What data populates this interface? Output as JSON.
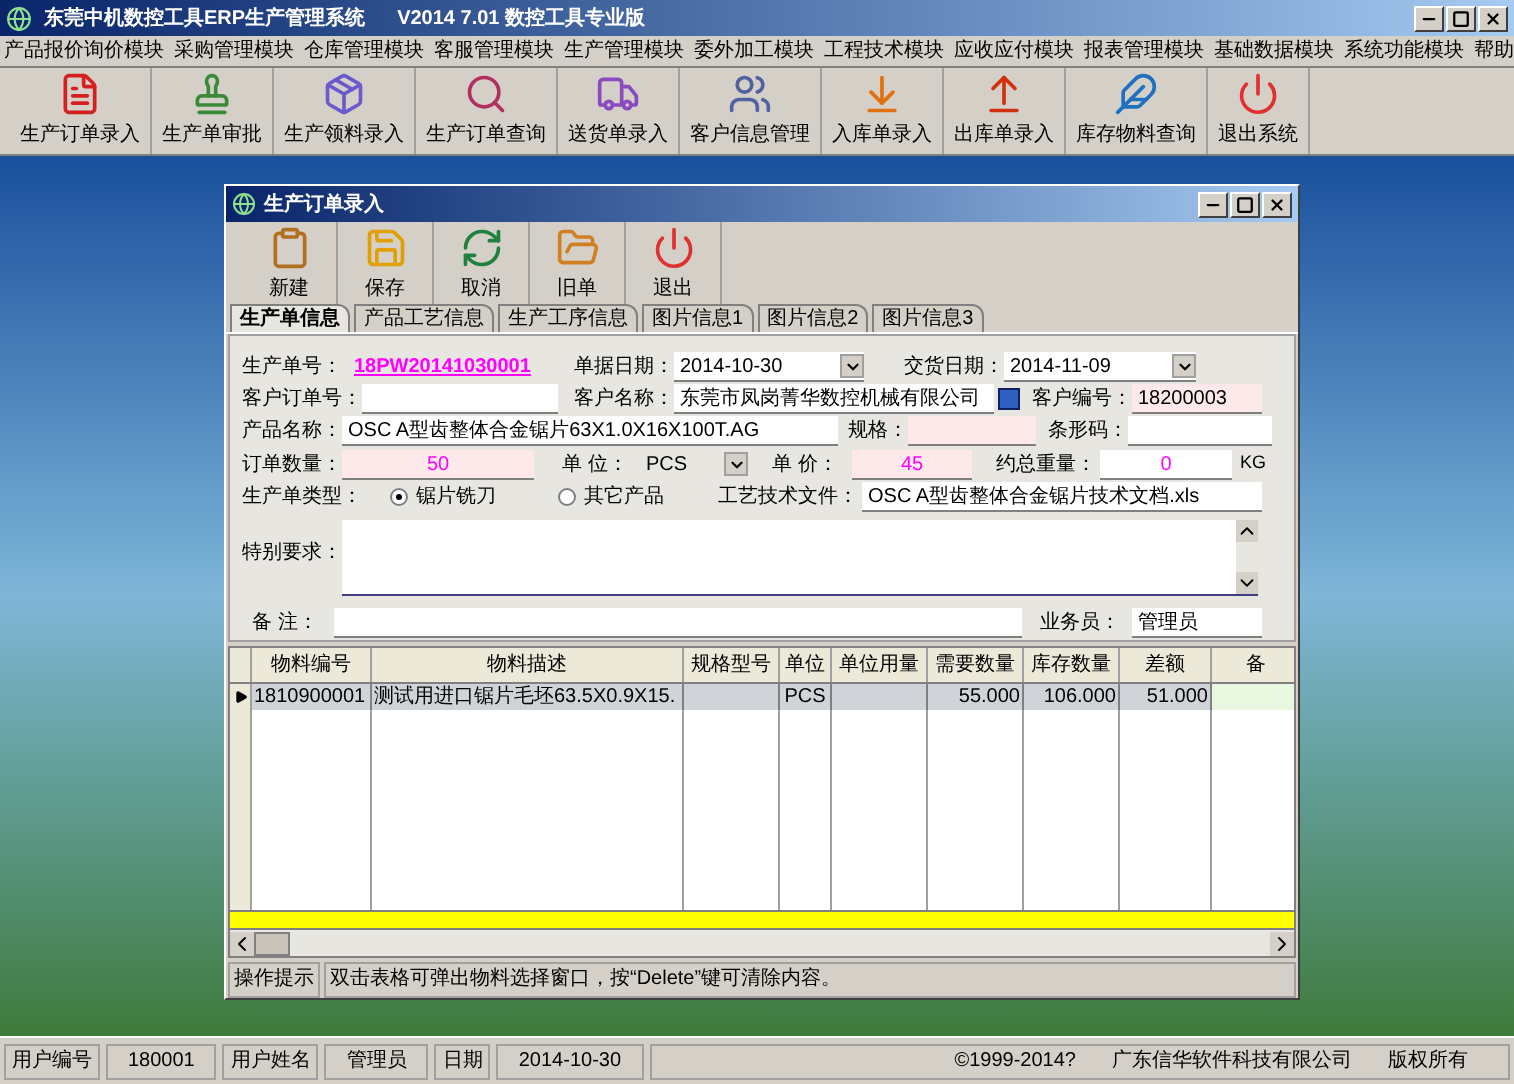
{
  "window": {
    "title": "东莞中机数控工具ERP生产管理系统",
    "edition": "V2014 7.01 数控工具专业版"
  },
  "menu": [
    "产品报价询价模块",
    "采购管理模块",
    "仓库管理模块",
    "客服管理模块",
    "生产管理模块",
    "委外加工模块",
    "工程技术模块",
    "应收应付模块",
    "报表管理模块",
    "基础数据模块",
    "系统功能模块",
    "帮助"
  ],
  "toolbar": [
    "生产订单录入",
    "生产单审批",
    "生产领料录入",
    "生产订单查询",
    "送货单录入",
    "客户信息管理",
    "入库单录入",
    "出库单录入",
    "库存物料查询",
    "退出系统"
  ],
  "dialog": {
    "title": "生产订单录入",
    "toolbar": [
      "新建",
      "保存",
      "取消",
      "旧单",
      "退出"
    ],
    "tabs": [
      {
        "label": "生产单信息",
        "selected": true
      },
      {
        "label": "产品工艺信息",
        "selected": false
      },
      {
        "label": "生产工序信息",
        "selected": false
      },
      {
        "label": "图片信息1",
        "selected": false
      },
      {
        "label": "图片信息2",
        "selected": false
      },
      {
        "label": "图片信息3",
        "selected": false
      }
    ],
    "form": {
      "order_no": {
        "label": "生产单号：",
        "value": "18PW20141030001"
      },
      "doc_date": {
        "label": "单据日期：",
        "value": "2014-10-30"
      },
      "delivery_date": {
        "label": "交货日期：",
        "value": "2014-11-09"
      },
      "customer_order_no": {
        "label": "客户订单号："
      },
      "customer_name": {
        "label": "客户名称：",
        "value": "东莞市凤岗菁华数控机械有限公司"
      },
      "customer_code": {
        "label": "客户编号：",
        "value": "18200003"
      },
      "product_name": {
        "label": "产品名称：",
        "value": "OSC A型齿整体合金锯片63X1.0X16X100T.AG"
      },
      "spec": {
        "label": "规格："
      },
      "barcode": {
        "label": "条形码："
      },
      "quantity": {
        "label": "订单数量：",
        "value": "50"
      },
      "unit": {
        "label": "单 位：",
        "value": "PCS"
      },
      "price": {
        "label": "单 价：",
        "value": "45"
      },
      "weight": {
        "label": "约总重量：",
        "value": "0",
        "unit": "KG"
      },
      "order_type": {
        "label": "生产单类型：",
        "options": [
          {
            "label": "锯片铣刀",
            "selected": true
          },
          {
            "label": "其它产品",
            "selected": false
          }
        ]
      },
      "process_file": {
        "label": "工艺技术文件：",
        "value": "OSC A型齿整体合金锯片技术文档.xls"
      },
      "requirements": {
        "label": "特别要求："
      },
      "remarks": {
        "label": "备 注："
      },
      "salesperson": {
        "label": "业务员：",
        "value": "管理员"
      }
    },
    "grid": {
      "columns": [
        "物料编号",
        "物料描述",
        "规格型号",
        "单位",
        "单位用量",
        "需要数量",
        "库存数量",
        "差额",
        "备"
      ],
      "rows": [
        {
          "selected": true,
          "cells": [
            "1810900001",
            "测试用进口锯片毛坯63.5X0.9X15.",
            "",
            "PCS",
            "",
            "55.000",
            "106.000",
            "51.000",
            ""
          ]
        }
      ]
    },
    "hint": {
      "label": "操作提示",
      "text": "双击表格可弹出物料选择窗口，按“Delete”键可清除内容。"
    }
  },
  "status_bar": [
    {
      "label": "用户编号",
      "value": "180001"
    },
    {
      "label": "用户姓名",
      "value": "管理员"
    },
    {
      "label": "日期",
      "value": "2014-10-30"
    }
  ],
  "copyright": [
    "©1999-2014?",
    "广东信华软件科技有限公司",
    "版权所有"
  ]
}
